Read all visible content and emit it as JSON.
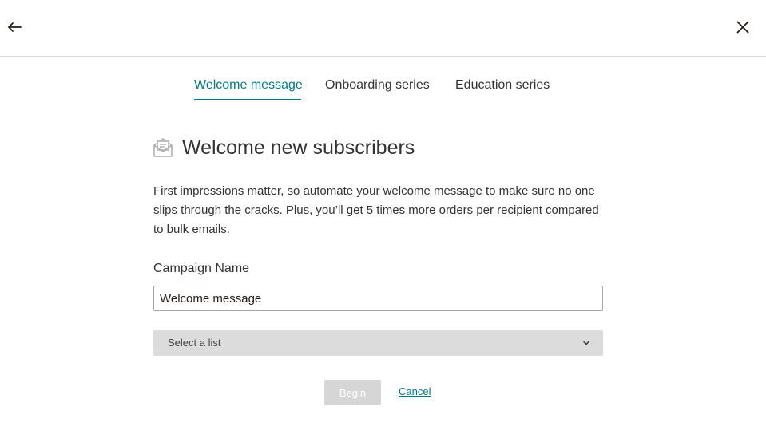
{
  "header": {
    "back_icon": "arrow-left-icon",
    "close_icon": "close-icon"
  },
  "tabs": [
    {
      "label": "Welcome message",
      "active": true
    },
    {
      "label": "Onboarding series",
      "active": false
    },
    {
      "label": "Education series",
      "active": false
    }
  ],
  "main": {
    "icon": "envelope-open-icon",
    "title": "Welcome new subscribers",
    "description": "First impressions matter, so automate your welcome message to make sure no one slips through the cracks. Plus, you’ll get 5 times more orders per recipient compared to bulk emails.",
    "campaign_name_label": "Campaign Name",
    "campaign_name_value": "Welcome message",
    "list_select_label": "Select a list",
    "begin_label": "Begin",
    "cancel_label": "Cancel"
  },
  "colors": {
    "accent": "#007c89",
    "disabled_button": "#d6d6d6",
    "select_background": "#dcdcdc"
  }
}
